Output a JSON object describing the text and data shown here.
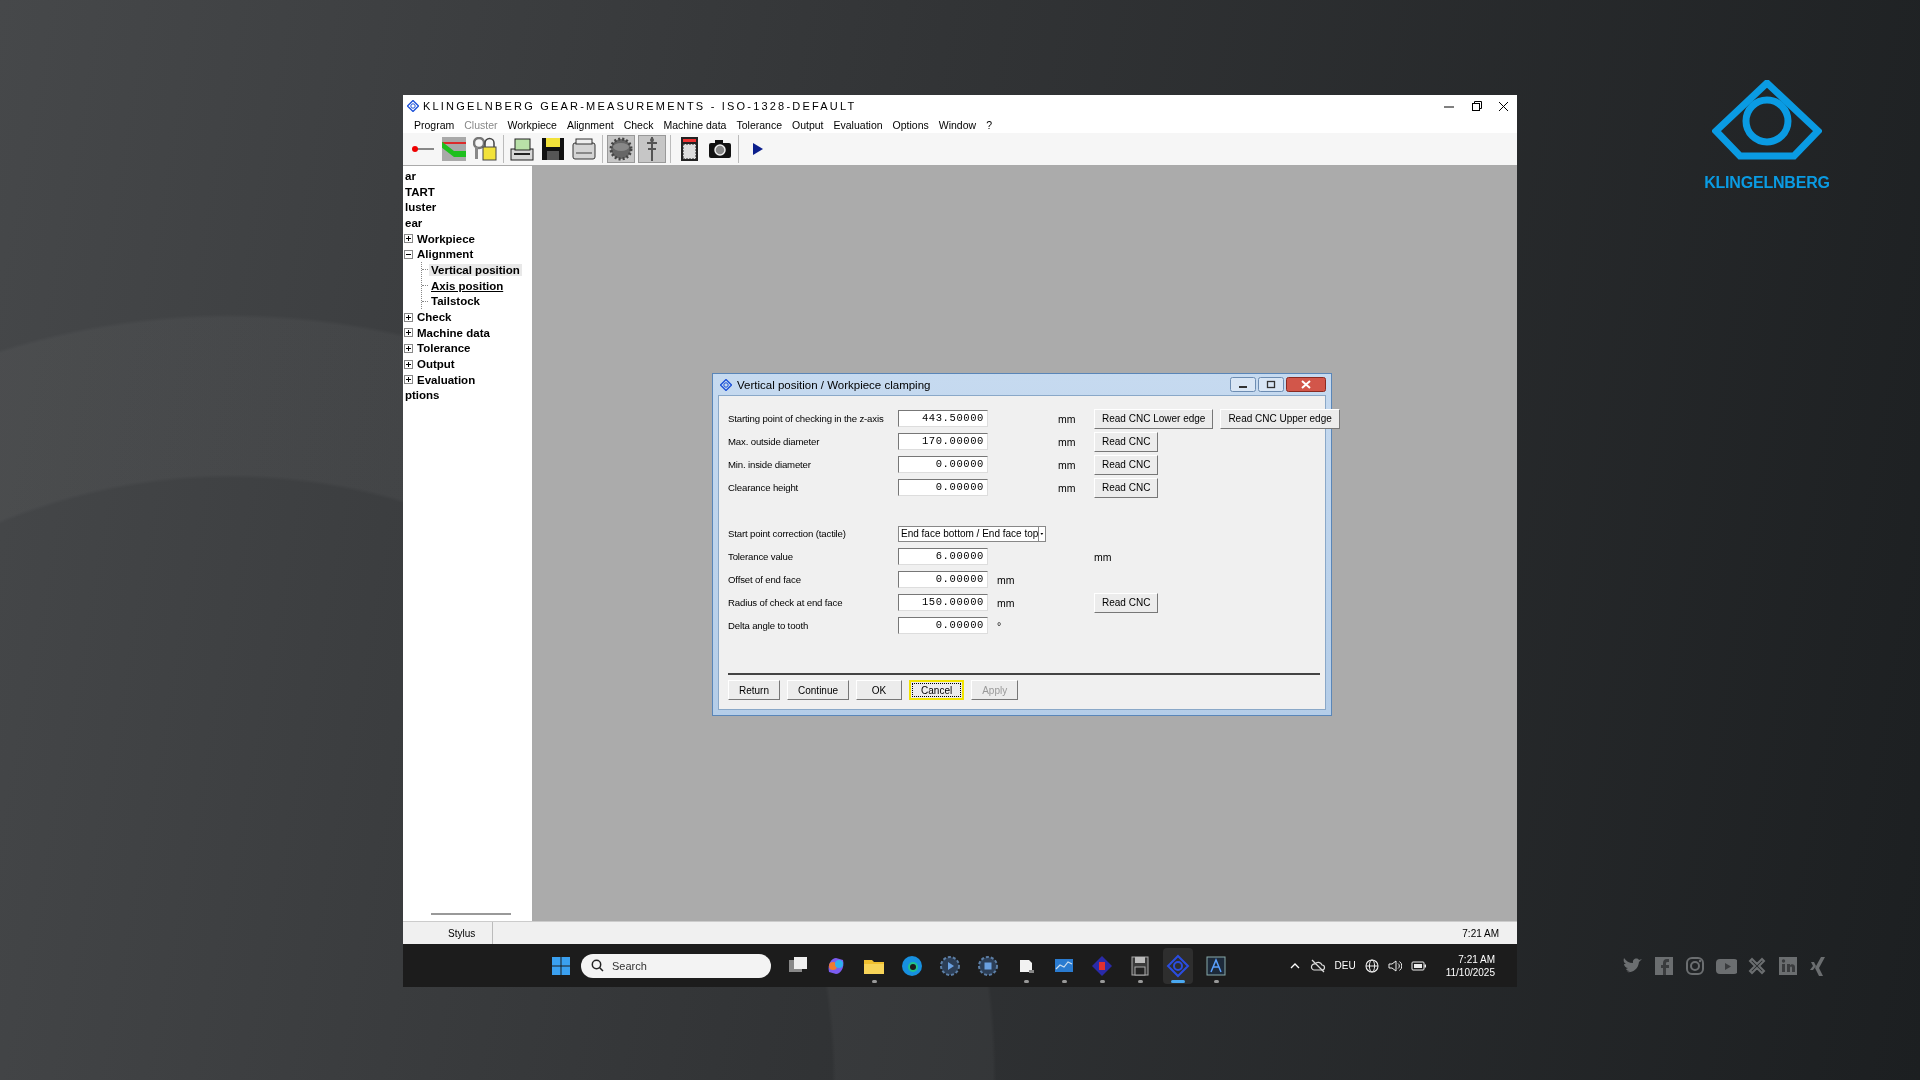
{
  "window": {
    "title": "KLINGELNBERG GEAR-MEASUREMENTS - ISO-1328-DEFAULT"
  },
  "menu": [
    {
      "label": "Program",
      "disabled": false
    },
    {
      "label": "Cluster",
      "disabled": true
    },
    {
      "label": "Workpiece",
      "disabled": false
    },
    {
      "label": "Alignment",
      "disabled": false
    },
    {
      "label": "Check",
      "disabled": false
    },
    {
      "label": "Machine data",
      "disabled": false
    },
    {
      "label": "Tolerance",
      "disabled": false
    },
    {
      "label": "Output",
      "disabled": false
    },
    {
      "label": "Evaluation",
      "disabled": false
    },
    {
      "label": "Options",
      "disabled": false
    },
    {
      "label": "Window",
      "disabled": false
    },
    {
      "label": "?",
      "disabled": false
    }
  ],
  "toolbar_groups": [
    {
      "buttons": [
        {
          "kind": "stylus",
          "pressed": false
        },
        {
          "kind": "chart",
          "pressed": false
        },
        {
          "kind": "keys",
          "pressed": false
        }
      ]
    },
    {
      "buttons": [
        {
          "kind": "register",
          "pressed": false
        },
        {
          "kind": "floppy",
          "pressed": false
        },
        {
          "kind": "printer",
          "pressed": false
        }
      ]
    },
    {
      "buttons": [
        {
          "kind": "gear",
          "pressed": true
        },
        {
          "kind": "probe",
          "pressed": true
        }
      ]
    },
    {
      "buttons": [
        {
          "kind": "calculator",
          "pressed": false
        },
        {
          "kind": "camera",
          "pressed": false
        }
      ]
    },
    {
      "buttons": [
        {
          "kind": "play",
          "pressed": false
        }
      ]
    }
  ],
  "tree": {
    "items": [
      {
        "kind": "root",
        "label": "ar",
        "selected": false,
        "hot": false
      },
      {
        "kind": "root",
        "label": "TART",
        "selected": false,
        "hot": false
      },
      {
        "kind": "root",
        "label": "luster",
        "selected": false,
        "hot": false
      },
      {
        "kind": "root",
        "label": "ear",
        "selected": false,
        "hot": false
      },
      {
        "kind": "node",
        "label": "Workpiece",
        "selected": false,
        "hot": false,
        "expanded": false
      },
      {
        "kind": "node",
        "label": "Alignment",
        "selected": false,
        "hot": false,
        "expanded": true,
        "children": [
          {
            "kind": "leaf",
            "label": "Vertical position",
            "selected": true,
            "hot": false
          },
          {
            "kind": "leaf",
            "label": "Axis position",
            "selected": false,
            "hot": true
          },
          {
            "kind": "leaf",
            "label": "Tailstock",
            "selected": false,
            "hot": false
          }
        ]
      },
      {
        "kind": "node",
        "label": "Check",
        "selected": false,
        "hot": false,
        "expanded": false
      },
      {
        "kind": "node",
        "label": "Machine data",
        "selected": false,
        "hot": false,
        "expanded": false
      },
      {
        "kind": "node",
        "label": "Tolerance",
        "selected": false,
        "hot": false,
        "expanded": false
      },
      {
        "kind": "node",
        "label": "Output",
        "selected": false,
        "hot": false,
        "expanded": false
      },
      {
        "kind": "node",
        "label": "Evaluation",
        "selected": false,
        "hot": false,
        "expanded": false
      },
      {
        "kind": "root",
        "label": "ptions",
        "selected": false,
        "hot": false
      }
    ]
  },
  "dialog": {
    "title": "Vertical position / Workpiece clamping",
    "rows": [
      {
        "kind": "far",
        "label": "Starting point of checking in the z-axis",
        "value": "443.50000",
        "unit": "mm",
        "buttons": [
          "Read CNC Lower edge",
          "Read CNC Upper edge"
        ]
      },
      {
        "kind": "far",
        "label": "Max. outside diameter",
        "value": "170.00000",
        "unit": "mm",
        "buttons": [
          "Read CNC"
        ]
      },
      {
        "kind": "far",
        "label": "Min. inside diameter",
        "value": "0.00000",
        "unit": "mm",
        "buttons": [
          "Read CNC"
        ]
      },
      {
        "kind": "far",
        "label": "Clearance height",
        "value": "0.00000",
        "unit": "mm",
        "buttons": [
          "Read CNC"
        ]
      },
      {
        "kind": "select",
        "label": "Start point correction (tactile)",
        "value": "End face bottom / End face top"
      },
      {
        "kind": "wide",
        "label": "Tolerance value",
        "value": "6.00000",
        "unit": "mm"
      },
      {
        "kind": "near",
        "label": "Offset of end face",
        "value": "0.00000",
        "unit": "mm"
      },
      {
        "kind": "near",
        "label": "Radius of check at end face",
        "value": "150.00000",
        "unit": "mm",
        "buttons": [
          "Read CNC"
        ]
      },
      {
        "kind": "near",
        "label": "Delta angle to tooth",
        "value": "0.00000",
        "unit": "°"
      }
    ],
    "actions": [
      {
        "label": "Return",
        "focused": false,
        "disabled": false
      },
      {
        "label": "Continue",
        "focused": false,
        "disabled": false
      },
      {
        "label": "OK",
        "focused": false,
        "disabled": false
      },
      {
        "label": "Cancel",
        "focused": true,
        "disabled": false
      },
      {
        "label": "Apply",
        "focused": false,
        "disabled": true
      }
    ]
  },
  "status_bar": {
    "cells": [
      "Stylus"
    ],
    "time": "7:21 AM"
  },
  "taskbar": {
    "search": {
      "placeholder": "Search"
    },
    "apps": [
      {
        "kind": "taskview",
        "running": false,
        "active": false
      },
      {
        "kind": "copilot",
        "running": false,
        "active": false
      },
      {
        "kind": "folder",
        "running": true,
        "active": false
      },
      {
        "kind": "browser",
        "running": false,
        "active": false
      },
      {
        "kind": "media",
        "running": false,
        "active": false
      },
      {
        "kind": "stopgear",
        "running": false,
        "active": false
      },
      {
        "kind": "document",
        "running": true,
        "active": false
      },
      {
        "kind": "monitor",
        "running": true,
        "active": false
      },
      {
        "kind": "diamond",
        "running": true,
        "active": false
      },
      {
        "kind": "floppy",
        "running": true,
        "active": false
      },
      {
        "kind": "gearapp",
        "running": true,
        "active": true
      },
      {
        "kind": "letter",
        "running": true,
        "active": false
      }
    ],
    "tray": {
      "language": "DEU",
      "time": "7:21 AM",
      "date": "11/10/2025"
    }
  },
  "brand": {
    "logo_text": "KLINGELNBERG"
  }
}
